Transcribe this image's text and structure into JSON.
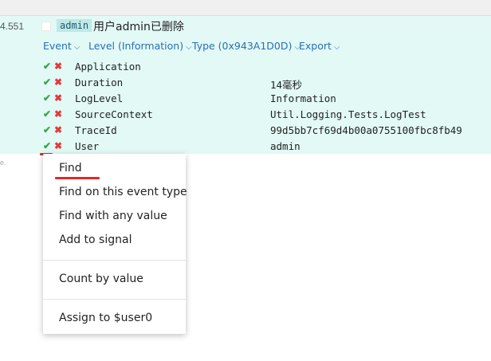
{
  "event": {
    "timestamp": "4.551",
    "tag": "admin",
    "message": "用户admin已删除"
  },
  "toolbar": {
    "items": [
      {
        "label": "Event"
      },
      {
        "label": "Level (Information)"
      },
      {
        "label": "Type (0x943A1D0D)"
      },
      {
        "label": "Export"
      }
    ]
  },
  "properties": [
    {
      "name": "Application",
      "value": ""
    },
    {
      "name": "Duration",
      "value": "14毫秒"
    },
    {
      "name": "LogLevel",
      "value": "Information"
    },
    {
      "name": "SourceContext",
      "value": "Util.Logging.Tests.LogTest"
    },
    {
      "name": "TraceId",
      "value": "99d5bb7cf69d4b00a0755100fbc8fb49"
    },
    {
      "name": "User",
      "value": "admin"
    }
  ],
  "icons": {
    "include": "check-icon",
    "exclude": "x-icon",
    "toolbar_chevron": "chevron-down-icon"
  },
  "colors": {
    "panel_bg": "#e2f9f5",
    "link": "#2a6fb5",
    "include": "#33a848",
    "exclude": "#e23b3b",
    "highlight": "#e02a2a"
  },
  "background_text": "e.",
  "context_menu": {
    "groups": [
      [
        "Find",
        "Find on this event type",
        "Find with any value",
        "Add to signal"
      ],
      [
        "Count by value"
      ],
      [
        "Assign to $user0"
      ]
    ]
  }
}
